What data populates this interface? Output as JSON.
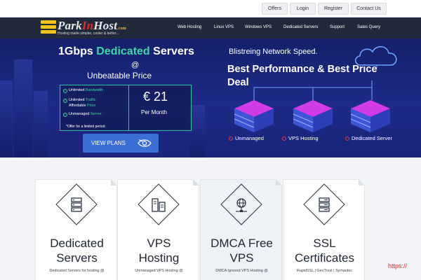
{
  "topbar": {
    "links": [
      "Offers",
      "Login",
      "Register",
      "Contact Us"
    ]
  },
  "nav": {
    "logo_main": "Park",
    "logo_accent": "In",
    "logo_end": "Host",
    "logo_suffix": ".com",
    "tagline": "Hosting made simpler, cooler & better...",
    "links": [
      "Web Hosting",
      "Linux VPS",
      "Windows VPS",
      "Dedicated Servers",
      "Support",
      "Sales Query"
    ]
  },
  "hero": {
    "title_prefix": "1Gbps ",
    "title_highlight": "Dedicated",
    "title_suffix": " Servers",
    "at": "@",
    "subtitle": "Unbeatable Price",
    "features": [
      {
        "prefix": "Unlimited ",
        "highlight": "Bandwidth"
      },
      {
        "prefix": "Unlimited ",
        "highlight": "Traffic"
      },
      {
        "prefix": "Affordable ",
        "highlight": "Price"
      },
      {
        "prefix": "Unmanaged ",
        "highlight": "Server"
      }
    ],
    "offer_note": "*Offer for a limited period",
    "price": "€ 21",
    "per": "Per Month",
    "view_plans": "VIEW PLANS",
    "right_small": "Blistreing Network Speed.",
    "right_big": "Best Performance & Best Price Deal",
    "right_labels": [
      "Unmanaged",
      "VPS Hosting",
      "Dedicated Server"
    ]
  },
  "cards": [
    {
      "title_line1": "Dedicated",
      "title_line2": "Servers",
      "desc": "Dedicated Servers for hosting @"
    },
    {
      "title_line1": "VPS",
      "title_line2": "Hosting",
      "desc": "Unmanaged VPS Hosting @"
    },
    {
      "title_line1": "DMCA Free",
      "title_line2": "VPS",
      "desc": "DMCA Ignored VPS Hosting @"
    },
    {
      "title_line1": "SSL",
      "title_line2": "Certificates",
      "desc": "RapidSSL | GeoTrust | Symantec"
    }
  ],
  "url_hint": "https://",
  "colors": {
    "nav_bg": "#212a3a",
    "hero_bg": "#1e2b86",
    "accent_green": "#3ed6a5",
    "button_blue": "#3b6fd6",
    "logo_red": "#e32c2c"
  }
}
